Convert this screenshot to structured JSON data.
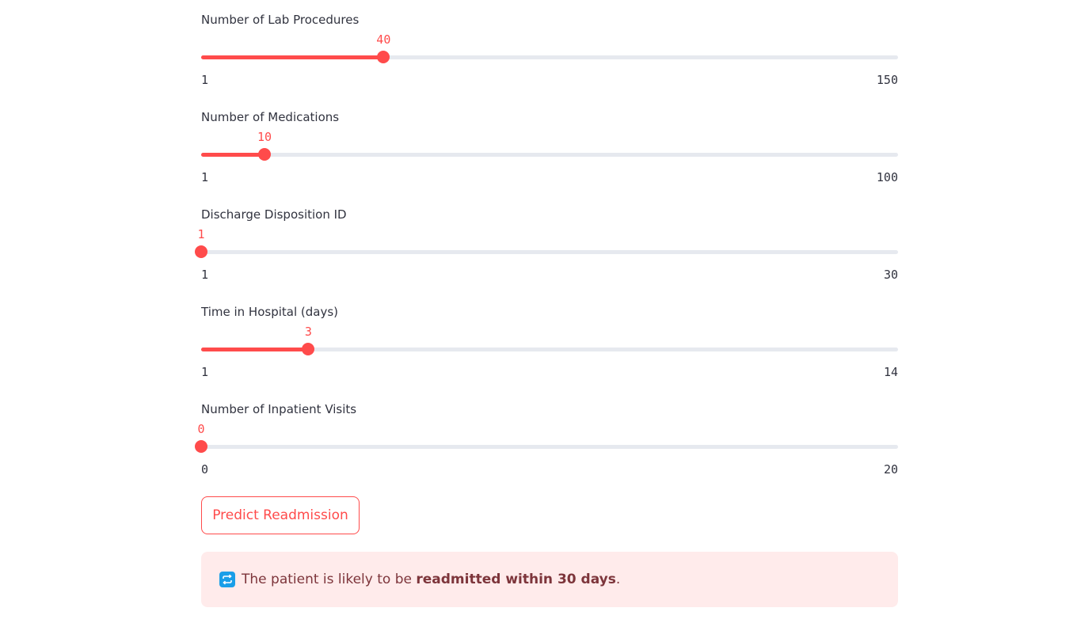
{
  "sliders": [
    {
      "label": "Number of Lab Procedures",
      "value": "40",
      "min": "1",
      "max": "150"
    },
    {
      "label": "Number of Medications",
      "value": "10",
      "min": "1",
      "max": "100"
    },
    {
      "label": "Discharge Disposition ID",
      "value": "1",
      "min": "1",
      "max": "30"
    },
    {
      "label": "Time in Hospital (days)",
      "value": "3",
      "min": "1",
      "max": "14"
    },
    {
      "label": "Number of Inpatient Visits",
      "value": "0",
      "min": "0",
      "max": "20"
    }
  ],
  "predict_button": {
    "label": "Predict Readmission"
  },
  "result": {
    "icon": "repeat-icon",
    "prefix": "The patient is likely to be ",
    "emphasis": "readmitted within 30 days",
    "suffix": "."
  },
  "colors": {
    "accent": "#ff4b4b",
    "track": "#e6e9ef",
    "alert_bg": "#ffebeb",
    "alert_text": "#7d353b",
    "icon_bg": "#1a9ee8"
  }
}
